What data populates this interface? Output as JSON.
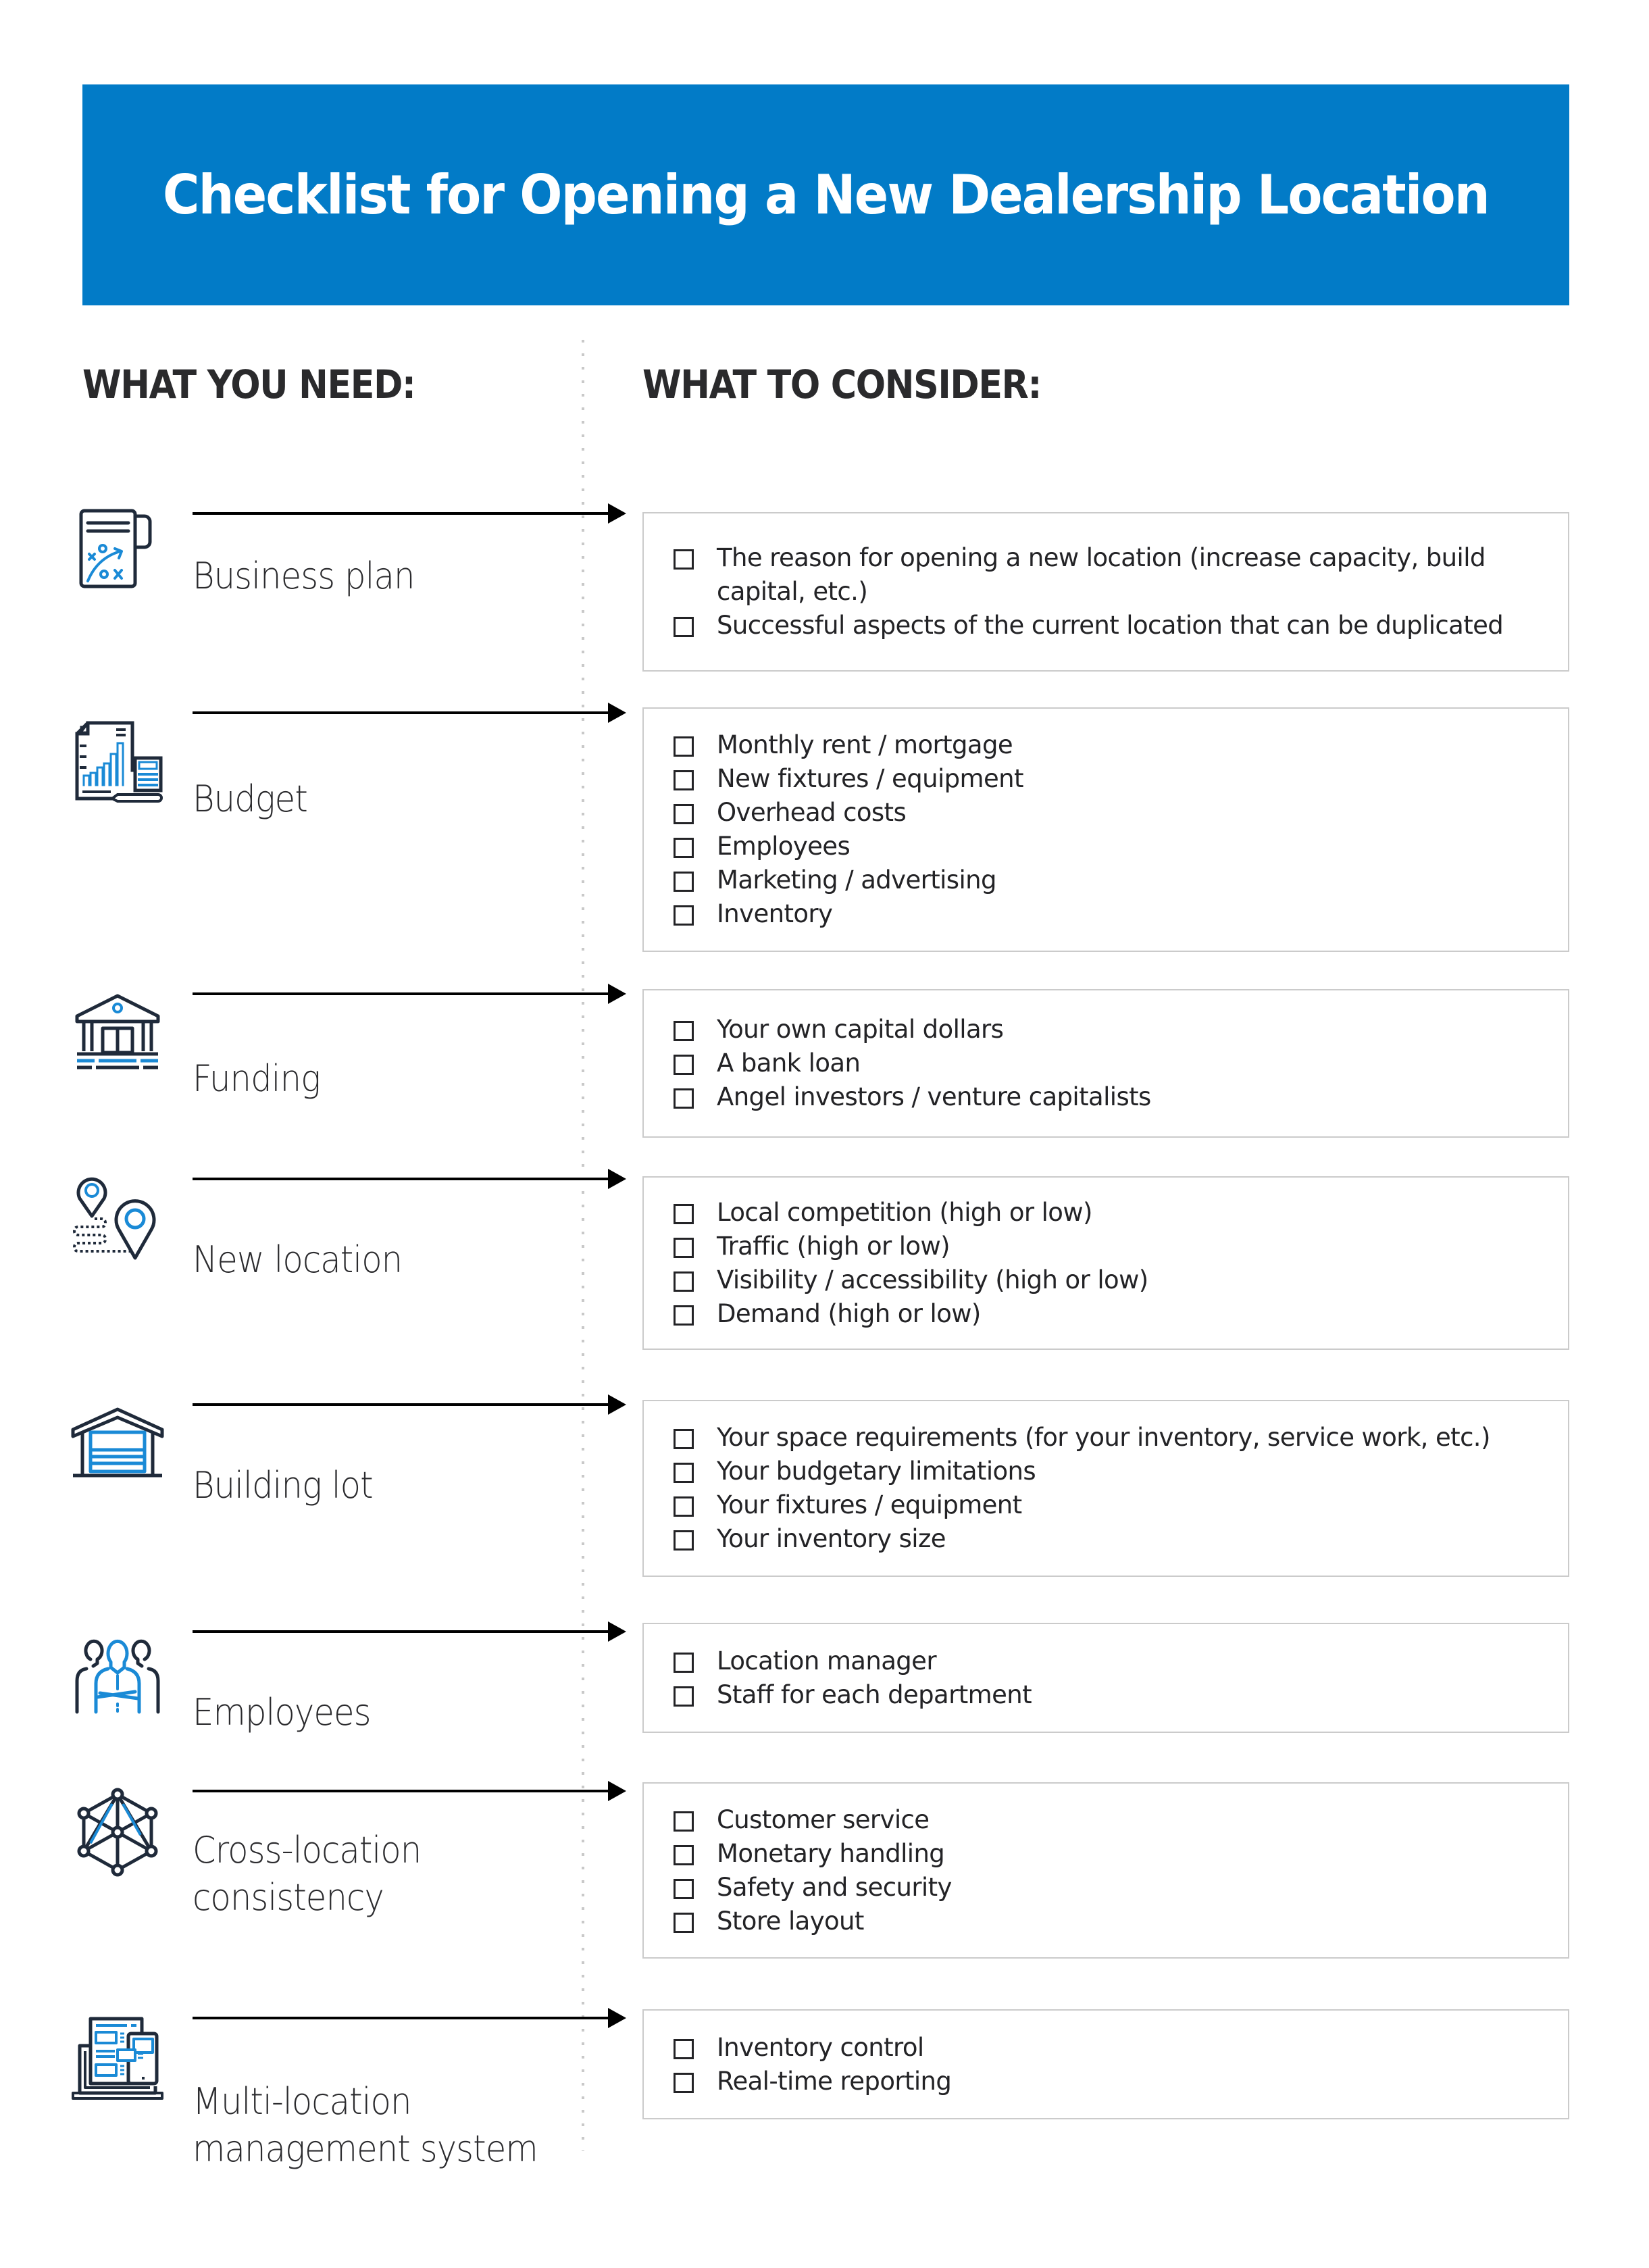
{
  "title": "Checklist for Opening a New Dealership Location",
  "headings": {
    "need": "WHAT YOU NEED:",
    "consider": "WHAT TO CONSIDER:"
  },
  "colors": {
    "banner": "#027bc7",
    "icon_accent": "#1a8ad6",
    "icon_dark": "#1f2a3a",
    "text": "#26272b",
    "box_border": "#cbcbcb"
  },
  "rows": [
    {
      "icon": "business-plan-scroll-icon",
      "label": "Business plan",
      "items": [
        "The reason for opening a new location (increase capacity, build capital, etc.)",
        "Successful aspects of the current location that can be duplicated"
      ]
    },
    {
      "icon": "budget-chart-calculator-icon",
      "label": "Budget",
      "items": [
        "Monthly rent / mortgage",
        "New fixtures / equipment",
        "Overhead costs",
        "Employees",
        "Marketing / advertising",
        "Inventory"
      ]
    },
    {
      "icon": "bank-building-icon",
      "label": "Funding",
      "items": [
        "Your own capital dollars",
        "A bank loan",
        "Angel investors / venture capitalists"
      ]
    },
    {
      "icon": "map-pins-route-icon",
      "label": "New location",
      "items": [
        "Local competition (high or low)",
        "Traffic (high or low)",
        "Visibility / accessibility (high or low)",
        "Demand (high or low)"
      ]
    },
    {
      "icon": "garage-building-icon",
      "label": "Building lot",
      "items": [
        "Your space requirements (for your inventory, service work, etc.)",
        "Your budgetary limitations",
        "Your fixtures / equipment",
        "Your inventory size"
      ]
    },
    {
      "icon": "team-people-icon",
      "label": "Employees",
      "items": [
        "Location manager",
        "Staff for each department"
      ]
    },
    {
      "icon": "network-hexagon-icon",
      "label_lines": [
        "Cross-location",
        "consistency"
      ],
      "items": [
        "Customer service",
        "Monetary handling",
        "Safety and security",
        "Store layout"
      ]
    },
    {
      "icon": "devices-dashboard-icon",
      "label_lines": [
        "Multi-location",
        "management system"
      ],
      "items": [
        "Inventory control",
        "Real-time reporting"
      ]
    }
  ]
}
